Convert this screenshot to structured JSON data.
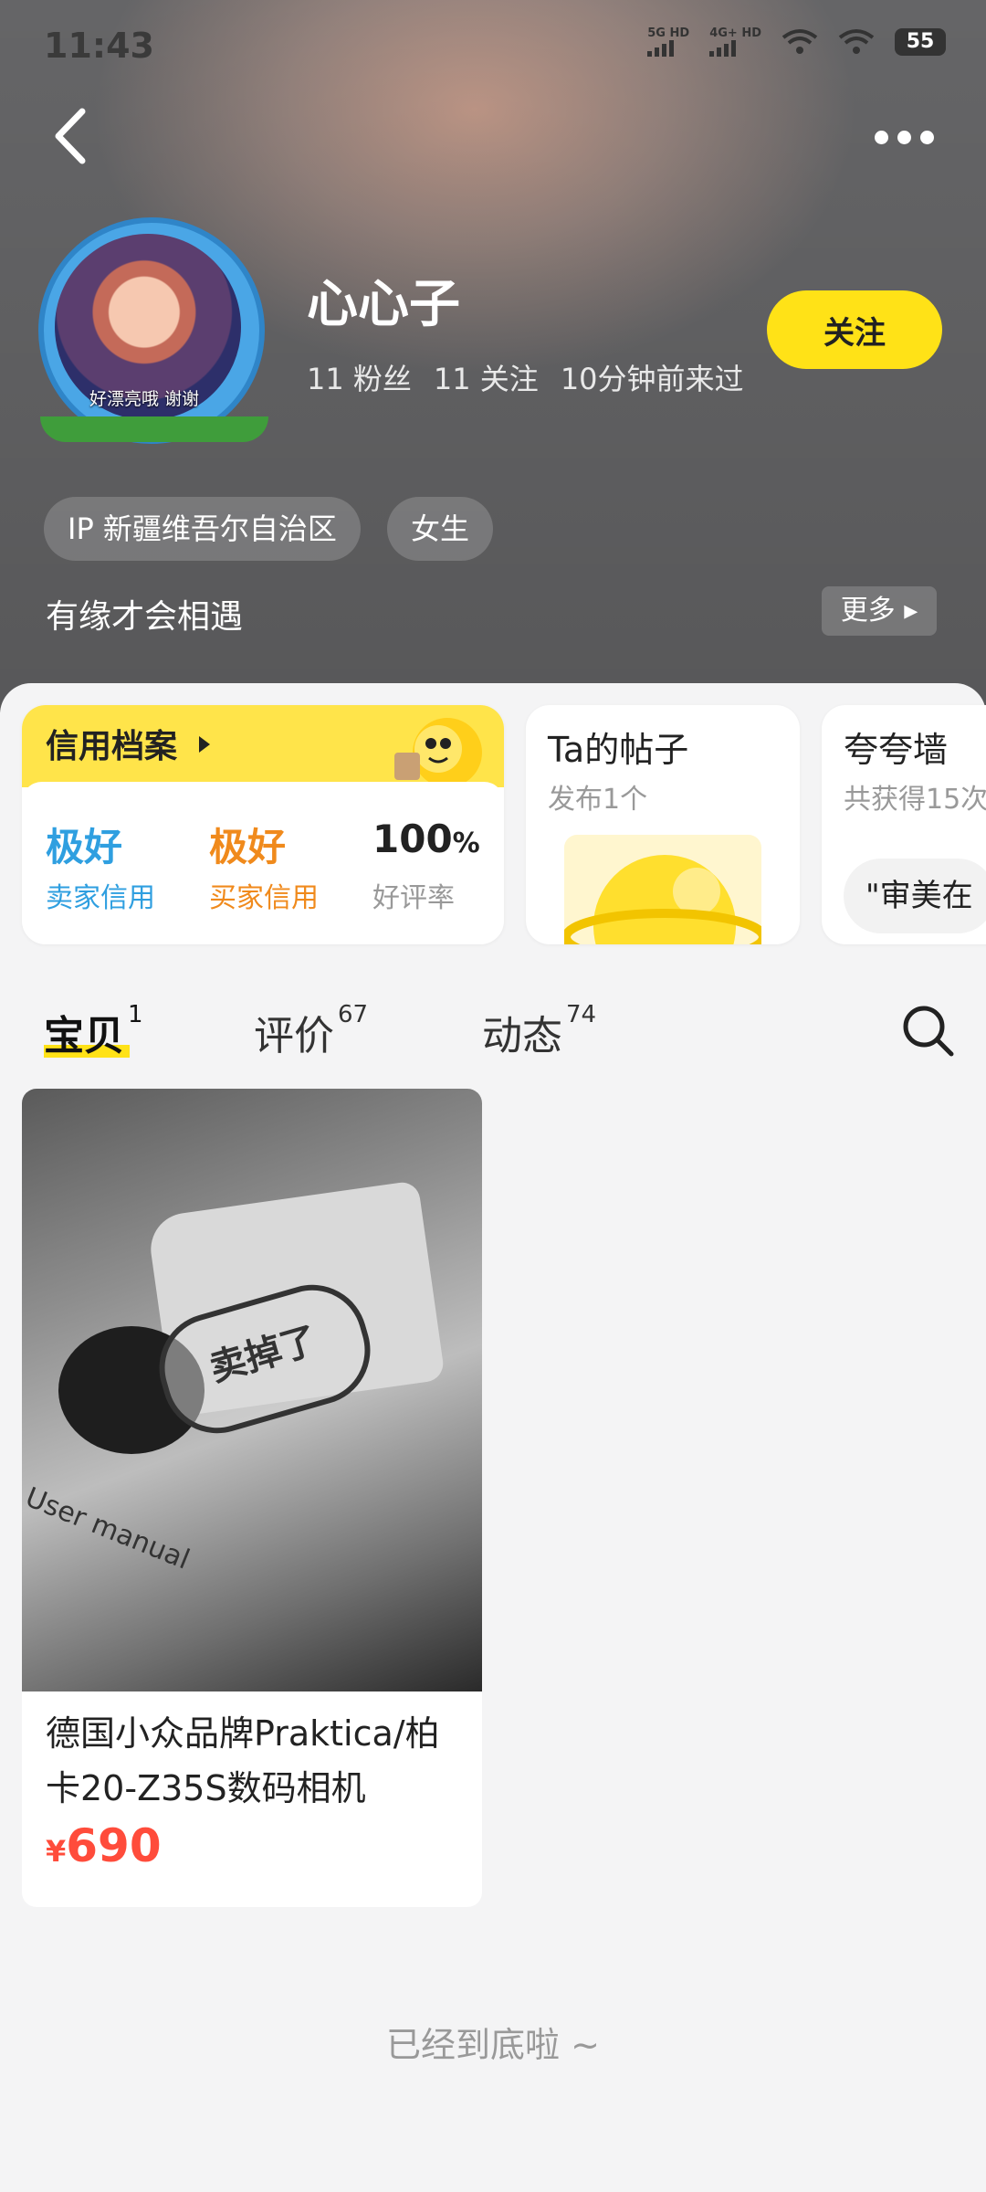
{
  "status_bar": {
    "time": "11:43",
    "signal1": "5G HD",
    "signal2": "4G+ HD",
    "battery": "55"
  },
  "profile": {
    "name": "心心子",
    "avatar_caption": "好漂亮哦 谢谢",
    "stats": [
      "11 粉丝",
      "11 关注",
      "10分钟前来过"
    ],
    "follow_label": "关注",
    "tags": [
      "IP 新疆维吾尔自治区",
      "女生"
    ],
    "bio": "有缘才会相遇",
    "more_label": "更多"
  },
  "cards": {
    "credit": {
      "title": "信用档案",
      "items": [
        {
          "value": "极好",
          "label": "卖家信用"
        },
        {
          "value": "极好",
          "label": "买家信用"
        },
        {
          "value": "100",
          "unit": "%",
          "label": "好评率"
        }
      ]
    },
    "posts": {
      "title": "Ta的帖子",
      "sub": "发布1个"
    },
    "praise": {
      "title": "夸夸墙",
      "sub": "共获得15次",
      "quote": "\"审美在"
    }
  },
  "tabs": [
    {
      "label": "宝贝",
      "count": "1"
    },
    {
      "label": "评价",
      "count": "67"
    },
    {
      "label": "动态",
      "count": "74"
    }
  ],
  "product": {
    "title": "德国小众品牌Praktica/柏卡20-Z35S数码相机",
    "currency": "¥",
    "price": "690",
    "stamp": "卖掉了",
    "image_text": "User manual"
  },
  "footer": {
    "end_text": "已经到底啦 ~"
  },
  "colors": {
    "accent": "#ffe217",
    "price": "#ff4c3b",
    "seller_credit": "#2f9fe0",
    "buyer_credit": "#f08a1c"
  },
  "icons": [
    "back-icon",
    "more-icon",
    "search-icon",
    "wifi-icon",
    "battery-icon",
    "play-triangle-icon",
    "planet-icon",
    "mascot-icon"
  ]
}
